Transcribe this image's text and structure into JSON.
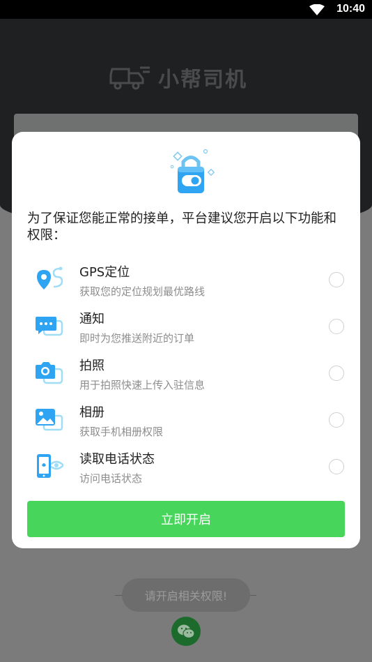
{
  "status_bar": {
    "time": "10:40"
  },
  "app": {
    "logo_text": "小帮司机",
    "toast": "请开启相关权限!"
  },
  "dialog": {
    "message": "为了保证您能正常的接单，平台建议您开启以下功能和权限：",
    "permissions": [
      {
        "title": "GPS定位",
        "desc": "获取您的定位规划最优路线",
        "icon": "location-icon"
      },
      {
        "title": "通知",
        "desc": "即时为您推送附近的订单",
        "icon": "chat-icon"
      },
      {
        "title": "拍照",
        "desc": "用于拍照快速上传入驻信息",
        "icon": "camera-icon"
      },
      {
        "title": "相册",
        "desc": "获取手机相册权限",
        "icon": "photo-icon"
      },
      {
        "title": "读取电话状态",
        "desc": "访问电话状态",
        "icon": "phone-icon"
      }
    ],
    "confirm_label": "立即开启"
  },
  "colors": {
    "accent_green": "#47d65b",
    "icon_blue": "#2fa4f3",
    "icon_light_blue": "#9fdcf6"
  }
}
